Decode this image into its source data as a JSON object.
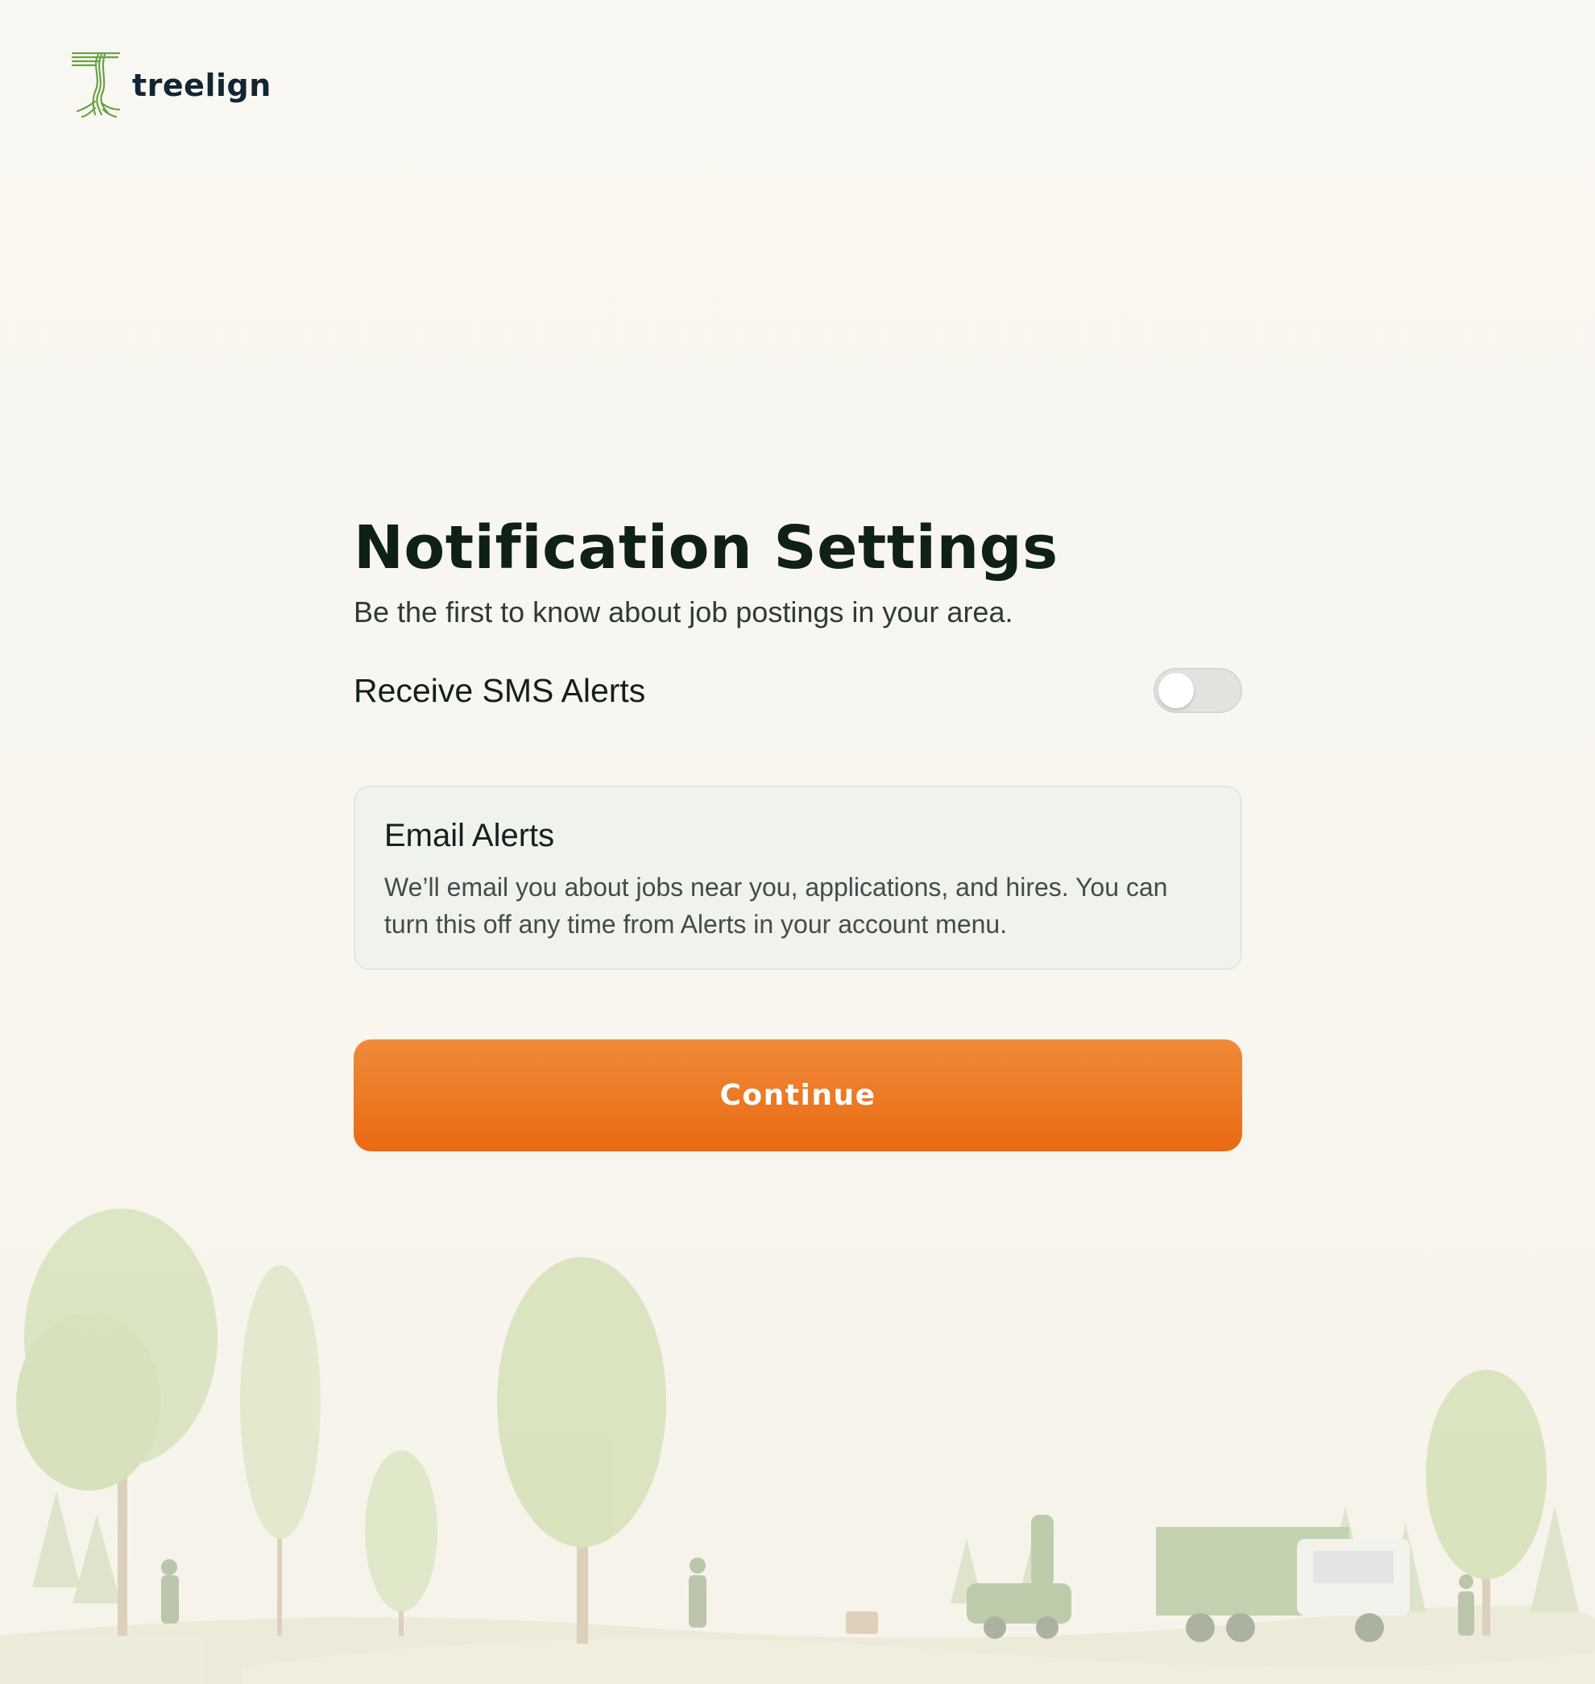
{
  "brand": {
    "name": "treelign",
    "accent_color": "#6aa247"
  },
  "page": {
    "title": "Notification Settings",
    "subtitle": "Be the first to know about job postings in your area."
  },
  "sms": {
    "label": "Receive SMS Alerts",
    "enabled": false
  },
  "email_card": {
    "title": "Email Alerts",
    "body": "We’ll email you about jobs near you, applications, and hires. You can turn this off any time from Alerts in your account menu."
  },
  "actions": {
    "continue_label": "Continue",
    "continue_color": "#ea6d15"
  }
}
